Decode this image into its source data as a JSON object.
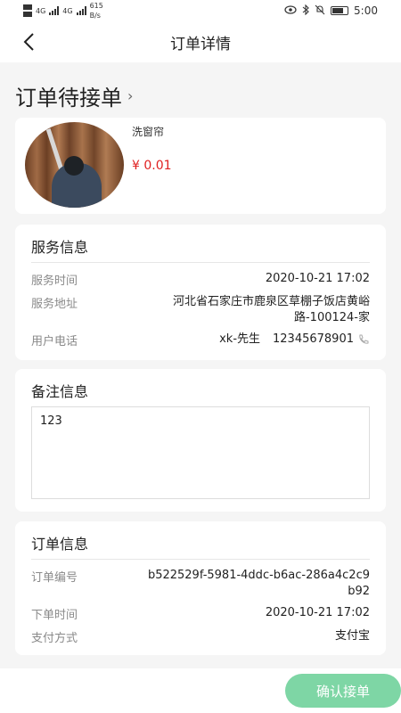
{
  "status_bar": {
    "net_speed": "615",
    "net_speed_unit": "B/s",
    "signal_left": "4G",
    "signal_right": "4G",
    "time": "5:00"
  },
  "nav": {
    "title": "订单详情"
  },
  "order_status": {
    "title": "订单待接单",
    "chevron": "›"
  },
  "product": {
    "name": "洗窗帘",
    "price": "¥ 0.01"
  },
  "service": {
    "header": "服务信息",
    "time_label": "服务时间",
    "time_value": "2020-10-21 17:02",
    "address_label": "服务地址",
    "address_line1": "河北省石家庄市鹿泉区草棚子饭店黄峪",
    "address_line2": "路-100124-家",
    "phone_label": "用户电话",
    "contact_name": "xk-先生",
    "phone_number": "12345678901"
  },
  "remark": {
    "header": "备注信息",
    "content": "123"
  },
  "order_info": {
    "header": "订单信息",
    "number_label": "订单编号",
    "number_line1": "b522529f-5981-4ddc-b6ac-286a4c2c9",
    "number_line2": "b92",
    "created_label": "下单时间",
    "created_value": "2020-10-21 17:02",
    "payment_label": "支付方式",
    "payment_value": "支付宝"
  },
  "actions": {
    "confirm_label": "确认接单"
  },
  "colors": {
    "price": "#e02020",
    "confirm_button": "#7ed6a5",
    "background": "#f5f5f5"
  }
}
